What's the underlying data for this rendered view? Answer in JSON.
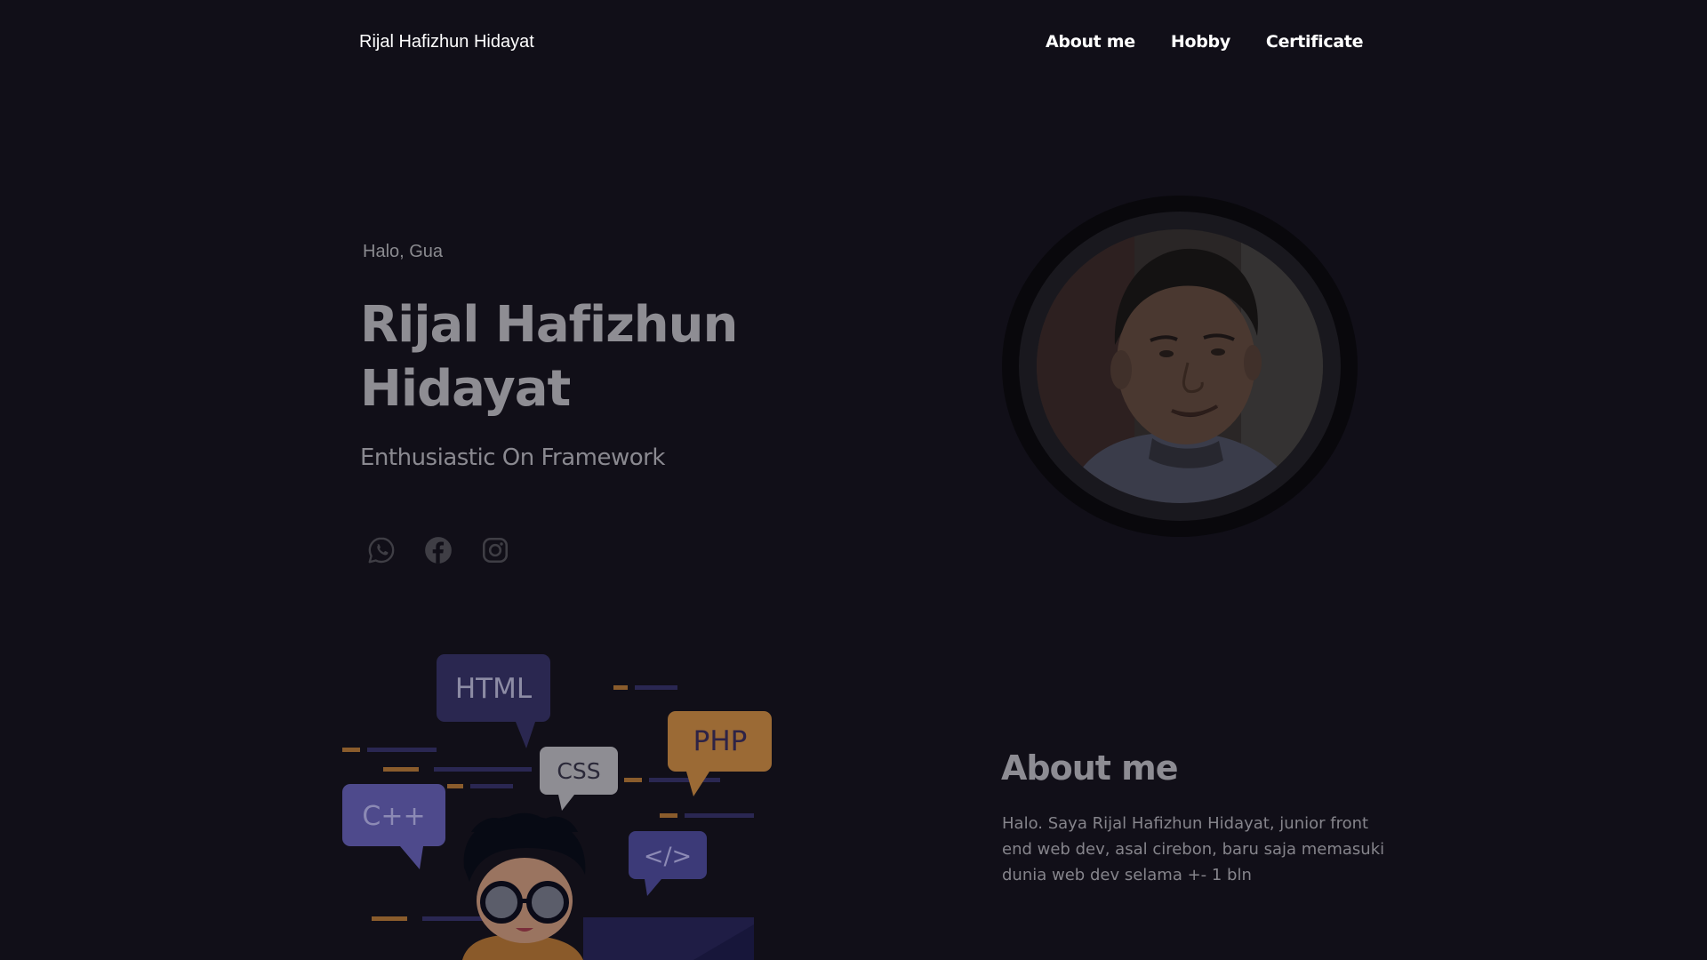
{
  "header": {
    "brand": "Rijal Hafizhun Hidayat",
    "nav": [
      "About me",
      "Hobby",
      "Certificate"
    ]
  },
  "hero": {
    "greeting": "Halo, Gua",
    "name": "Rijal Hafizhun Hidayat",
    "tagline": "Enthusiastic On Framework",
    "socials": [
      "whatsapp-icon",
      "facebook-icon",
      "instagram-icon"
    ]
  },
  "illustration": {
    "bubbles": [
      "HTML",
      "PHP",
      "CSS",
      "C++",
      "</>"
    ]
  },
  "about": {
    "title": "About me",
    "text": "Halo. Saya Rijal Hafizhun Hidayat, junior front end web dev, asal cirebon, baru saja memasuki dunia web dev selama +- 1 bln"
  },
  "colors": {
    "background": "#110f18",
    "bubble_navy": "#2a2750",
    "bubble_orange": "#9b6a35",
    "bubble_purple": "#4e4a8c",
    "bubble_grey": "#8e8d93"
  }
}
